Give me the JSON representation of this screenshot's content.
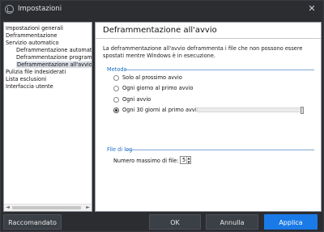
{
  "window": {
    "title": "Impostazioni",
    "close_glyph": "✕"
  },
  "sidebar": {
    "items": [
      {
        "label": "Impostazioni generali"
      },
      {
        "label": "Deframmentazione"
      },
      {
        "label": "Servizio automatico"
      },
      {
        "label": "Deframmentazione automatic"
      },
      {
        "label": "Deframmentazione programm"
      },
      {
        "label": "Deframmentazione all'avvio",
        "selected": true
      },
      {
        "label": "Pulizia file indesiderati"
      },
      {
        "label": "Lista esclusioni"
      },
      {
        "label": "Interfaccia utente"
      }
    ],
    "scroll_left": "◄",
    "scroll_right": "►"
  },
  "content": {
    "heading": "Deframmentazione all'avvio",
    "description": "La deframmentazione all'avvio deframmenta i file che non possono essere spostati mentre Windows è in esecuzione.",
    "method": {
      "title": "Metodo",
      "options": [
        {
          "label": "Solo al prossimo avvio",
          "checked": false
        },
        {
          "label": "Ogni giorno al primo avvio",
          "checked": false
        },
        {
          "label": "Ogni avvio",
          "checked": false
        },
        {
          "label": "Ogni 30 giorni al primo avvio",
          "checked": true
        }
      ],
      "slider_level": 1.0
    },
    "log": {
      "title": "File di log",
      "max_files_label": "Numero massimo di file:",
      "max_files_value": "5",
      "stepper_up": "▲",
      "stepper_down": "▼"
    }
  },
  "footer": {
    "recommended_label": "Raccomandato",
    "ok_label": "OK",
    "cancel_label": "Annulla",
    "apply_label": "Applica"
  },
  "colors": {
    "accent": "#1a7ae8",
    "group_title": "#1d6fc2",
    "chrome_dark": "#2b2d31"
  }
}
